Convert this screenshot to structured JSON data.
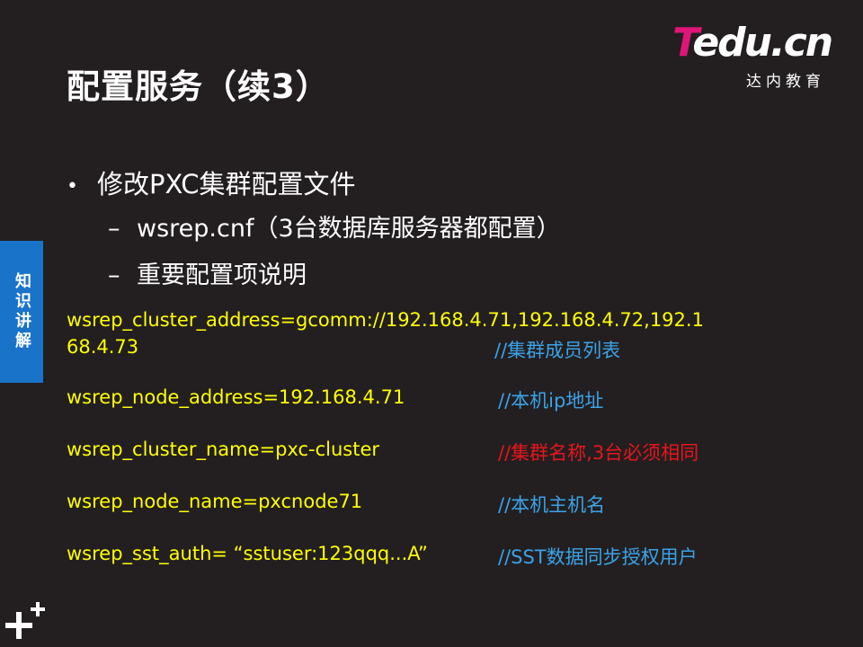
{
  "title": "配置服务（续3）",
  "logo": {
    "mark_t": "T",
    "mark_rest": "edu.cn",
    "subtitle": "达内教育",
    "accent": "#e0157a"
  },
  "side_tab": {
    "label": "知识讲解",
    "color": "#1973c8"
  },
  "bullets": {
    "main": "修改PXC集群配置文件",
    "sub": [
      "wsrep.cnf（3台数据库服务器都配置）",
      "重要配置项说明"
    ]
  },
  "config": [
    {
      "line1": "wsrep_cluster_address=gcomm://192.168.4.71,192.168.4.72,192.1",
      "line2": "68.4.73",
      "comment": "//集群成员列表",
      "comment_color": "blue"
    },
    {
      "line1": "wsrep_node_address=192.168.4.71",
      "comment": "//本机ip地址",
      "comment_color": "blue"
    },
    {
      "line1": "wsrep_cluster_name=pxc-cluster",
      "comment": "//集群名称,3台必须相同",
      "comment_color": "red"
    },
    {
      "line1": "wsrep_node_name=pxcnode71",
      "comment": "//本机主机名",
      "comment_color": "blue"
    },
    {
      "line1": "wsrep_sst_auth= “sstuser:123qqq...A”",
      "comment": "//SST数据同步授权用户",
      "comment_color": "blue"
    }
  ],
  "colors": {
    "background": "#231f20",
    "code": "#ffff00",
    "comment_blue": "#3ba3e8",
    "comment_red": "#e8151b"
  }
}
